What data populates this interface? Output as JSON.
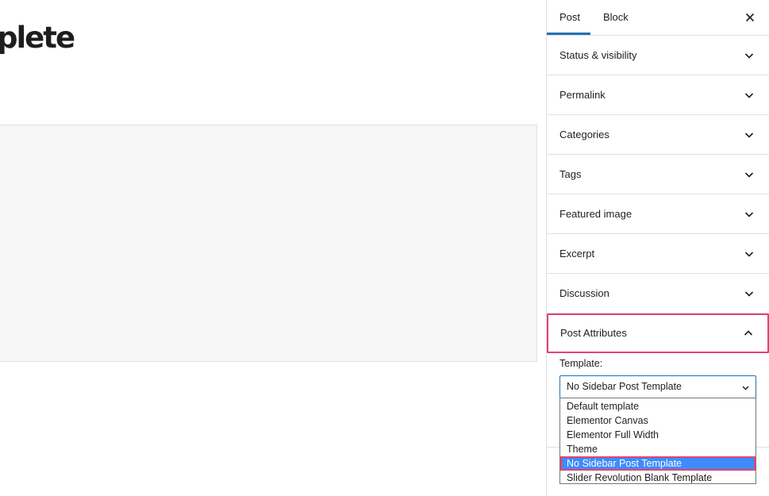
{
  "editor": {
    "title_fragment": "plete"
  },
  "sidebar": {
    "tabs": [
      {
        "label": "Post"
      },
      {
        "label": "Block"
      }
    ],
    "close_glyph": "✕",
    "panels": [
      {
        "label": "Status & visibility"
      },
      {
        "label": "Permalink"
      },
      {
        "label": "Categories"
      },
      {
        "label": "Tags"
      },
      {
        "label": "Featured image"
      },
      {
        "label": "Excerpt"
      },
      {
        "label": "Discussion"
      }
    ],
    "post_attributes": {
      "label": "Post Attributes",
      "template_label": "Template:",
      "selected_value": "No Sidebar Post Template",
      "options": [
        "Default template",
        "Elementor Canvas",
        "Elementor Full Width",
        "Theme",
        "No Sidebar Post Template",
        "Slider Revolution Blank Template"
      ]
    }
  },
  "colors": {
    "accent": "#2271b1",
    "highlight_outline": "#e2446c",
    "option_selected_bg": "#3d8bfd"
  }
}
